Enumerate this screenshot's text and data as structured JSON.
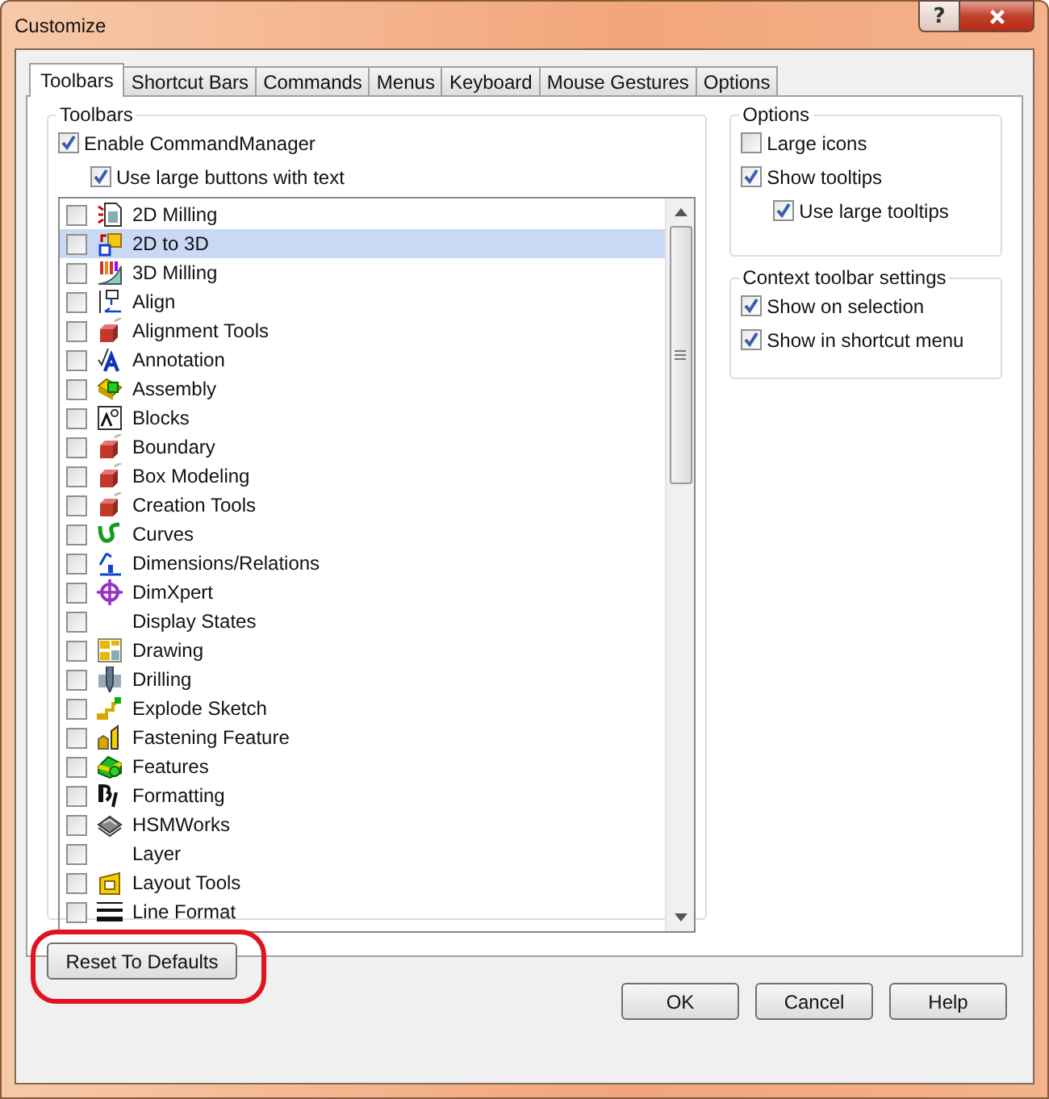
{
  "window": {
    "title": "Customize",
    "help_button": "?"
  },
  "tabs": [
    {
      "label": "Toolbars",
      "selected": true
    },
    {
      "label": "Shortcut Bars",
      "selected": false
    },
    {
      "label": "Commands",
      "selected": false
    },
    {
      "label": "Menus",
      "selected": false
    },
    {
      "label": "Keyboard",
      "selected": false
    },
    {
      "label": "Mouse Gestures",
      "selected": false
    },
    {
      "label": "Options",
      "selected": false
    }
  ],
  "toolbars_group": {
    "title": "Toolbars",
    "options": [
      {
        "label": "Enable CommandManager",
        "checked": true,
        "children": [
          {
            "label": "Use large buttons with text",
            "checked": true
          }
        ]
      }
    ],
    "items": [
      {
        "label": "2D Milling",
        "checked": false,
        "selected": false
      },
      {
        "label": "2D to 3D",
        "checked": false,
        "selected": true
      },
      {
        "label": "3D Milling",
        "checked": false,
        "selected": false
      },
      {
        "label": "Align",
        "checked": false,
        "selected": false
      },
      {
        "label": "Alignment Tools",
        "checked": false,
        "selected": false
      },
      {
        "label": "Annotation",
        "checked": false,
        "selected": false
      },
      {
        "label": "Assembly",
        "checked": false,
        "selected": false
      },
      {
        "label": "Blocks",
        "checked": false,
        "selected": false
      },
      {
        "label": "Boundary",
        "checked": false,
        "selected": false
      },
      {
        "label": "Box Modeling",
        "checked": false,
        "selected": false
      },
      {
        "label": "Creation Tools",
        "checked": false,
        "selected": false
      },
      {
        "label": "Curves",
        "checked": false,
        "selected": false
      },
      {
        "label": "Dimensions/Relations",
        "checked": false,
        "selected": false
      },
      {
        "label": "DimXpert",
        "checked": false,
        "selected": false
      },
      {
        "label": "Display States",
        "checked": false,
        "selected": false
      },
      {
        "label": "Drawing",
        "checked": false,
        "selected": false
      },
      {
        "label": "Drilling",
        "checked": false,
        "selected": false
      },
      {
        "label": "Explode Sketch",
        "checked": false,
        "selected": false
      },
      {
        "label": "Fastening Feature",
        "checked": false,
        "selected": false
      },
      {
        "label": "Features",
        "checked": false,
        "selected": false
      },
      {
        "label": "Formatting",
        "checked": false,
        "selected": false
      },
      {
        "label": "HSMWorks",
        "checked": false,
        "selected": false
      },
      {
        "label": "Layer",
        "checked": false,
        "selected": false
      },
      {
        "label": "Layout Tools",
        "checked": false,
        "selected": false
      },
      {
        "label": "Line Format",
        "checked": false,
        "selected": false
      }
    ],
    "reset_button": "Reset To Defaults"
  },
  "options_group": {
    "title": "Options",
    "options": [
      {
        "label": "Large icons",
        "checked": false
      },
      {
        "label": "Show tooltips",
        "checked": true,
        "children": [
          {
            "label": "Use large tooltips",
            "checked": true
          }
        ]
      }
    ]
  },
  "context_group": {
    "title": "Context toolbar settings",
    "options": [
      {
        "label": "Show on selection",
        "checked": true
      },
      {
        "label": "Show in shortcut menu",
        "checked": true
      }
    ]
  },
  "buttons": [
    "OK",
    "Cancel",
    "Help"
  ]
}
